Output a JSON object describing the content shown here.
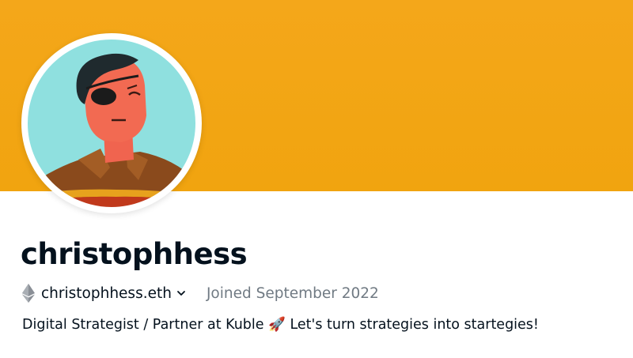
{
  "profile": {
    "banner_color": "#F2A511",
    "avatar_icon": "cartoon-portrait-eyepatch",
    "username": "christophhess",
    "ens_icon": "ethereum-icon",
    "ens_name": "christophhess.eth",
    "ens_dropdown_icon": "chevron-down-icon",
    "joined": "Joined September 2022",
    "bio": "Digital Strategist / Partner at Kuble 🚀 Let's turn strategies into startegies!"
  }
}
